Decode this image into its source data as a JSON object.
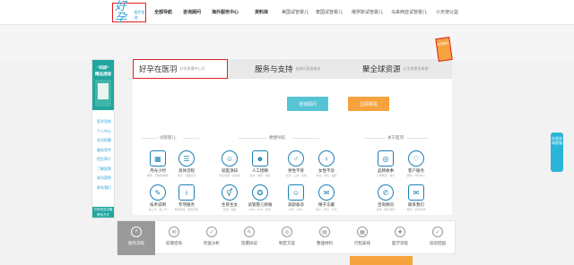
{
  "header": {
    "logo_mark": "好孕",
    "logo_text": "医疗咨询",
    "nav": [
      {
        "label": "全部导航",
        "bold": true
      },
      {
        "label": "咨询顾问",
        "bold": true
      },
      {
        "label": "海外服务中心",
        "bold": true
      },
      {
        "label": "资料库",
        "bold": true
      },
      {
        "label": "美国试管婴儿",
        "bold": false
      },
      {
        "label": "泰国试管婴儿",
        "bold": false
      },
      {
        "label": "俄罗斯试管婴儿",
        "bold": false
      },
      {
        "label": "马来西亚试管婴儿",
        "bold": false
      },
      {
        "label": "小天使公益",
        "bold": false
      }
    ]
  },
  "sidebar": {
    "head_line1": "“科研”",
    "head_line2": "精品透视",
    "links": [
      "医学导航",
      "个人中心",
      "学员招募",
      "服务宣传",
      "招生简介",
      "了解医院",
      "成功案例",
      "联系我们"
    ],
    "foot": "马来西亚试管联系方式"
  },
  "tabs": [
    {
      "title": "好孕在医羽",
      "sub": "好孕直播中心开"
    },
    {
      "title": "服务与支持",
      "sub": "由顾问直接服务"
    },
    {
      "title": "聚全球资源",
      "sub": "让生育更多希望"
    }
  ],
  "buttons": {
    "consult": "咨询顾问",
    "apply": "立即报名"
  },
  "groups": [
    {
      "title": "试管婴儿"
    },
    {
      "title": "便捷导航"
    },
    {
      "title": "关于医羽"
    }
  ],
  "services": [
    {
      "label": "月光小时",
      "sub": "服务 · 定制新体验",
      "icon": "calculator-icon",
      "glyph": "▦"
    },
    {
      "label": "具体流程",
      "sub": "当天 · 流程方法",
      "icon": "clipboard-icon",
      "glyph": "☰"
    },
    {
      "label": "就医须知",
      "sub": "常见问题 · 办签名",
      "icon": "doctor-icon",
      "glyph": "☺"
    },
    {
      "label": "人工授精",
      "sub": "女性 · 男性 · 进阶",
      "icon": "nurse-icon",
      "glyph": "☻"
    },
    {
      "label": "男性不育",
      "sub": "北京 · 上海 · 深圳",
      "icon": "person-icon",
      "glyph": "♂"
    },
    {
      "label": "女性不孕",
      "sub": "女性 · 男性 · 进阶",
      "icon": "female-icon",
      "glyph": "♀"
    },
    {
      "label": "品牌故事",
      "sub": "公司概况 · 官方",
      "icon": "globe-icon",
      "glyph": "◎"
    },
    {
      "label": "客户服务",
      "sub": "服务 · 评价中心",
      "icon": "heart-icon",
      "glyph": "♡"
    },
    {
      "label": "技术说明",
      "sub": "第三代 · 第二代",
      "icon": "pen-icon",
      "glyph": "✎"
    },
    {
      "label": "专项服务",
      "sub": "费用包含 · 服务项目",
      "icon": "info-icon",
      "glyph": "i"
    },
    {
      "label": "生育生女",
      "sub": "可选 · 性别",
      "icon": "gender-icon",
      "glyph": "⚥"
    },
    {
      "label": "试管婴儿移植",
      "sub": "PGD · PGS · 技术",
      "icon": "medal-icon",
      "glyph": "✪"
    },
    {
      "label": "高龄备孕",
      "sub": "40岁 · 45岁+",
      "icon": "elder-icon",
      "glyph": "☺"
    },
    {
      "label": "精子冻藏",
      "sub": "精子 · 卵子 · 冷冻",
      "icon": "document-icon",
      "glyph": "✉"
    },
    {
      "label": "咨询顾问",
      "sub": "在线 · 官方顾问",
      "icon": "chat-icon",
      "glyph": "✆"
    },
    {
      "label": "联系我们",
      "sub": "服务 · 合作伙伴",
      "icon": "contact-icon",
      "glyph": "✉"
    }
  ],
  "bottom": [
    {
      "label": "服务流程",
      "icon": "plus-circle-icon",
      "glyph": "+",
      "active": true
    },
    {
      "label": "前期咨询",
      "icon": "chat-icon",
      "glyph": "✉",
      "active": false
    },
    {
      "label": "检查分析",
      "icon": "check-icon",
      "glyph": "✓",
      "active": false
    },
    {
      "label": "签署协议",
      "icon": "document-icon",
      "glyph": "✎",
      "active": false
    },
    {
      "label": "制定方案",
      "icon": "target-icon",
      "glyph": "◎",
      "active": false
    },
    {
      "label": "整理材料",
      "icon": "folder-icon",
      "glyph": "▤",
      "active": false
    },
    {
      "label": "行程安排",
      "icon": "calendar-icon",
      "glyph": "▦",
      "active": false
    },
    {
      "label": "医学流程",
      "icon": "medical-icon",
      "glyph": "✚",
      "active": false
    },
    {
      "label": "验孕回国",
      "icon": "check-circle-icon",
      "glyph": "✓",
      "active": false
    }
  ],
  "note": "试管报名",
  "float_tab": "在线咨询客服"
}
